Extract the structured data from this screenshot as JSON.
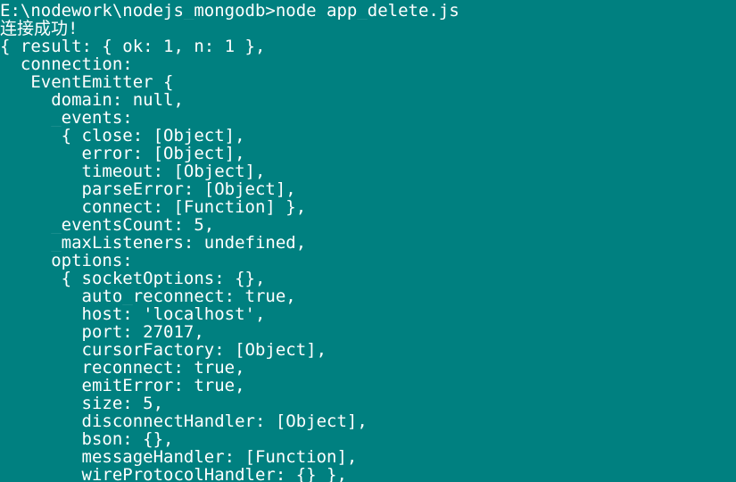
{
  "console": {
    "prompt_line": "E:\\nodework\\nodejs_mongodb>node app_delete.js",
    "lines": [
      "连接成功!",
      "{ result: { ok: 1, n: 1 },",
      "  connection:",
      "   EventEmitter {",
      "     domain: null,",
      "     _events:",
      "      { close: [Object],",
      "        error: [Object],",
      "        timeout: [Object],",
      "        parseError: [Object],",
      "        connect: [Function] },",
      "     _eventsCount: 5,",
      "     _maxListeners: undefined,",
      "     options:",
      "      { socketOptions: {},",
      "        auto_reconnect: true,",
      "        host: 'localhost',",
      "        port: 27017,",
      "        cursorFactory: [Object],",
      "        reconnect: true,",
      "        emitError: true,",
      "        size: 5,",
      "        disconnectHandler: [Object],",
      "        bson: {},",
      "        messageHandler: [Function],",
      "        wireProtocolHandler: {} },"
    ]
  },
  "colors": {
    "background": "#008080",
    "text": "#ffffff"
  }
}
